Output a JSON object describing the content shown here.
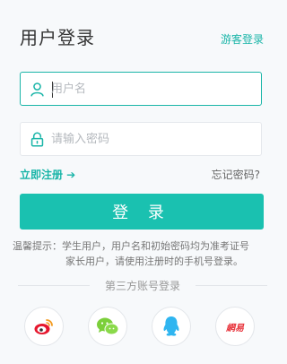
{
  "header": {
    "title": "用户登录",
    "guest_link": "游客登录"
  },
  "form": {
    "username_placeholder": "用户名",
    "password_placeholder": "请输入密码",
    "register_link": "立即注册 ➔",
    "forgot_link": "忘记密码?",
    "login_button": "登 录"
  },
  "tip": {
    "line1": "温馨提示：学生用户，用户名和初始密码均为准考证号",
    "line2": "家长用户，请使用注册时的手机号登录。"
  },
  "third_party": {
    "label": "第三方账号登录",
    "items": [
      {
        "name": "weibo-icon"
      },
      {
        "name": "wechat-icon"
      },
      {
        "name": "qq-icon"
      },
      {
        "name": "netease-icon",
        "text": "網易"
      }
    ]
  },
  "colors": {
    "accent": "#1ab5a8",
    "button": "#1ac1b0"
  }
}
